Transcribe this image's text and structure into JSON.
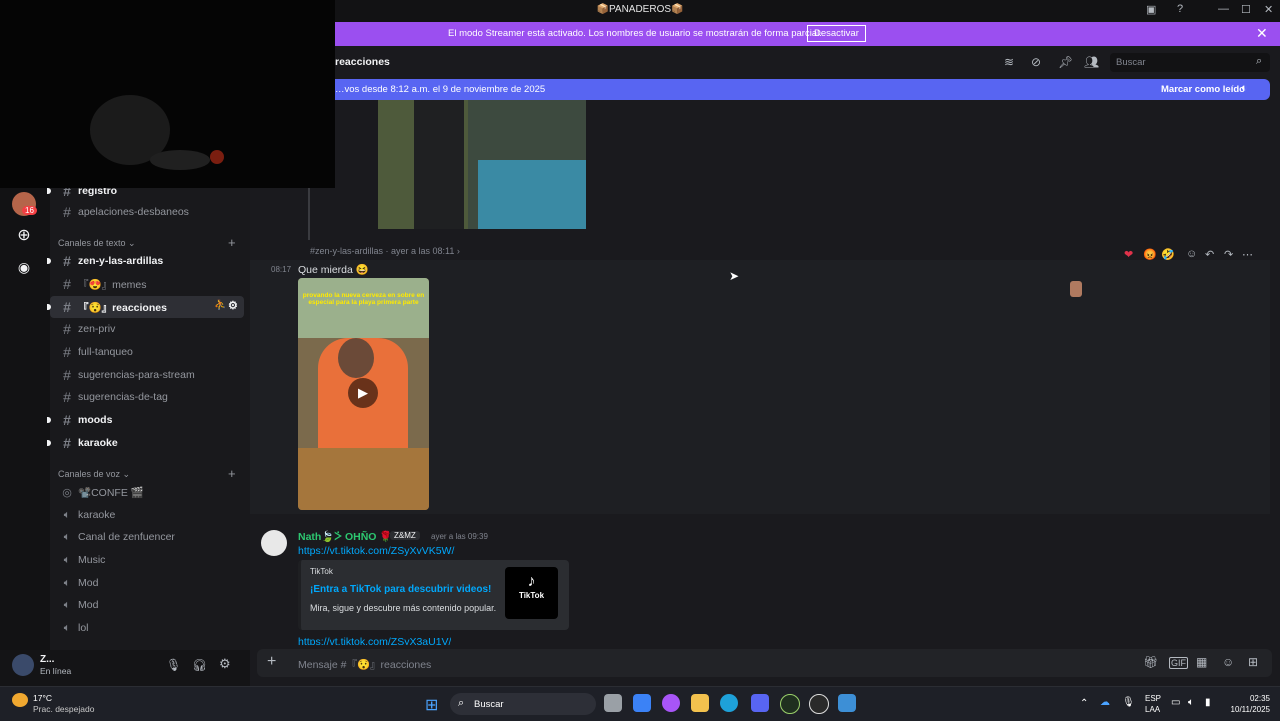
{
  "window": {
    "title": "📦PANADEROS📦"
  },
  "streamer_banner": {
    "text": "El modo Streamer está activado. Los nombres de usuario se mostrarán de forma parcial.",
    "button": "Desactivar"
  },
  "channel_header": {
    "name": "reacciones",
    "search_placeholder": "Buscar"
  },
  "new_messages_bar": {
    "text": "…vos desde 8:12 a.m. el 9 de noviembre de 2025",
    "action": "Marcar como leído"
  },
  "rail": {
    "badge": "16"
  },
  "sidebar": {
    "top_channels": [
      {
        "name": "registro",
        "bold": true
      },
      {
        "name": "apelaciones-desbaneos",
        "bold": false
      }
    ],
    "text_category": "Canales de texto",
    "text_channels": [
      {
        "name": "zen-y-las-ardillas",
        "bold": true
      },
      {
        "name": "『😍』memes",
        "bold": false
      },
      {
        "name": "『😯』reacciones",
        "bold": true
      },
      {
        "name": "zen-priv",
        "bold": false
      },
      {
        "name": "full-tanqueo",
        "bold": false
      },
      {
        "name": "sugerencias-para-stream",
        "bold": false
      },
      {
        "name": "sugerencias-de-tag",
        "bold": false
      },
      {
        "name": "moods",
        "bold": true
      },
      {
        "name": "karaoke",
        "bold": true
      }
    ],
    "voice_category": "Canales de voz",
    "voice_channels": [
      "📽️CONFE 🎬",
      "karaoke",
      "Canal de zenfuencer",
      "Music",
      "Mod",
      "Mod",
      "lol"
    ]
  },
  "user": {
    "name": "Z...",
    "status": "En línea"
  },
  "messages": {
    "forward_source": "#zen-y-las-ardillas",
    "forward_time": "ayer a las 08:11 ›",
    "msg1_time": "08:17",
    "msg1_text": "Que mierda",
    "video_caption": "provando la nueva cerveza en sobre en especial para la playa primera parte",
    "msg2_author": "Nath🍃ᢴ OHÑO 🌹 ♀",
    "msg2_tag": "Z&MZ",
    "msg2_time": "ayer a las 09:39",
    "msg2_link": "https://vt.tiktok.com/ZSyXvVK5W/",
    "embed_provider": "TikTok",
    "embed_title": "¡Entra a TikTok para descubrir videos!",
    "embed_desc": "Mira, sigue y descubre más contenido popular.",
    "embed_logo_text": "TikTok",
    "msg2_link2": "https://vt.tiktok.com/ZSyX3aU1V/"
  },
  "composer": {
    "placeholder": "Mensaje #『😯』reacciones"
  },
  "taskbar": {
    "weather_temp": "17°C",
    "weather_desc": "Prac. despejado",
    "search": "Buscar",
    "lang": "ESP",
    "lang2": "LAA",
    "time": "02:35",
    "date": "10/11/2025"
  },
  "colors": {
    "accent": "#5865f2",
    "streamer": "#9b4ff0",
    "link": "#00a8fc",
    "bg": "#1a1a1e"
  }
}
